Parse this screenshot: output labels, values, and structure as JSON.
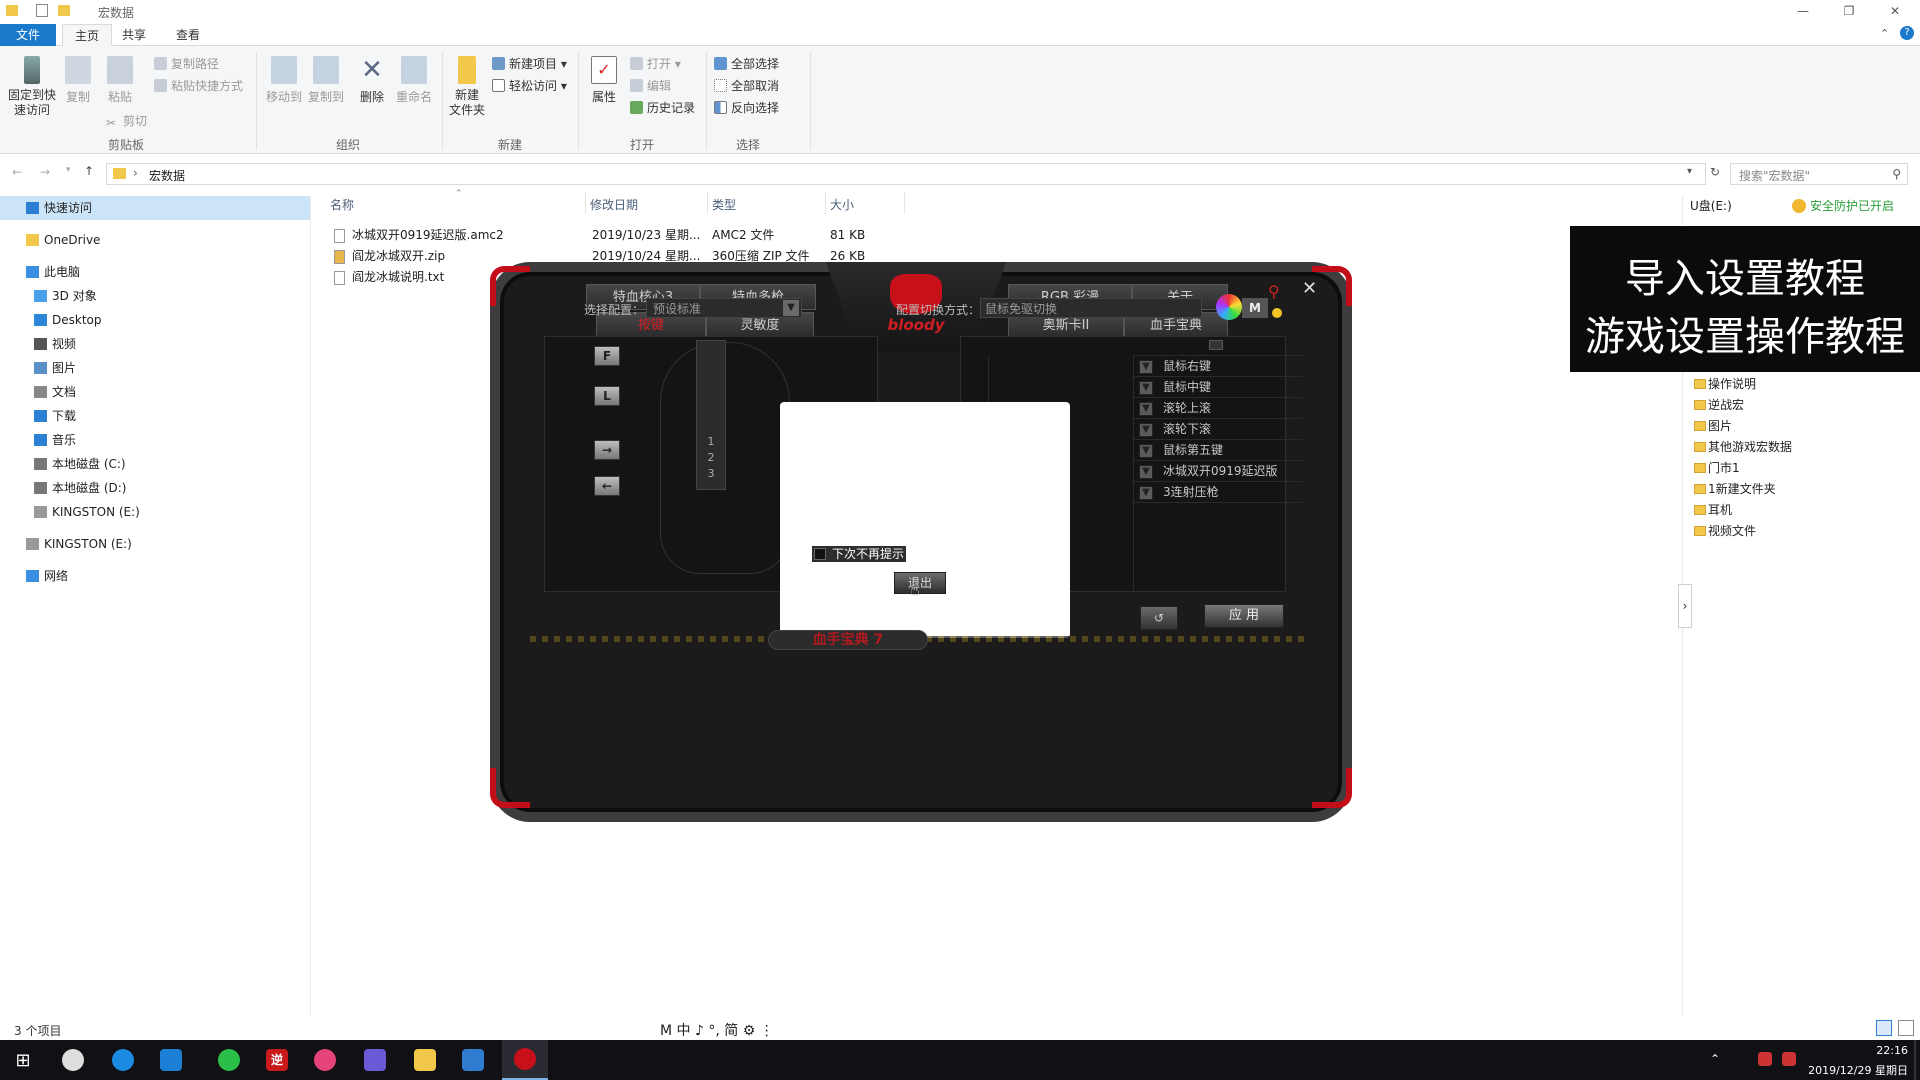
{
  "window": {
    "title": "宏数据"
  },
  "ribbon_tabs": [
    "文件",
    "主页",
    "共享",
    "查看"
  ],
  "ribbon": {
    "pin": "固定到快\n速访问",
    "copy": "复制",
    "paste": "粘贴",
    "copy_path": "复制路径",
    "paste_shortcut": "粘贴快捷方式",
    "cut": "剪切",
    "clipboard_group": "剪贴板",
    "move_to": "移动到",
    "copy_to": "复制到",
    "delete": "删除",
    "rename": "重命名",
    "organize_group": "组织",
    "new_item": "新建项目 ▾",
    "easy_access": "轻松访问 ▾",
    "new_folder": "新建\n文件夹",
    "new_group": "新建",
    "properties": "属性",
    "open": "打开 ▾",
    "edit": "编辑",
    "history": "历史记录",
    "open_group": "打开",
    "select_all": "全部选择",
    "select_none": "全部取消",
    "invert_selection": "反向选择",
    "select_group": "选择"
  },
  "address": {
    "path": "宏数据",
    "search_placeholder": "搜索\"宏数据\""
  },
  "nav": [
    {
      "label": "快速访问",
      "color": "#2d7fd4",
      "selected": true,
      "indent": 0
    },
    {
      "label": "OneDrive",
      "color": "#f2c84b",
      "indent": 0
    },
    {
      "label": "此电脑",
      "color": "#3b8de0",
      "indent": 0
    },
    {
      "label": "3D 对象",
      "color": "#4aa0e6",
      "indent": 1
    },
    {
      "label": "Desktop",
      "color": "#2f86d8",
      "indent": 1
    },
    {
      "label": "视频",
      "color": "#555",
      "indent": 1
    },
    {
      "label": "图片",
      "color": "#5a8fc7",
      "indent": 1
    },
    {
      "label": "文档",
      "color": "#888",
      "indent": 1
    },
    {
      "label": "下载",
      "color": "#2d7fd4",
      "indent": 1
    },
    {
      "label": "音乐",
      "color": "#2d7fd4",
      "indent": 1
    },
    {
      "label": "本地磁盘 (C:)",
      "color": "#777",
      "indent": 1
    },
    {
      "label": "本地磁盘 (D:)",
      "color": "#777",
      "indent": 1
    },
    {
      "label": "KINGSTON (E:)",
      "color": "#999",
      "indent": 1
    },
    {
      "label": "KINGSTON (E:)",
      "color": "#999",
      "indent": 0
    },
    {
      "label": "网络",
      "color": "#3b8de0",
      "indent": 0
    }
  ],
  "columns": {
    "name": "名称",
    "modified": "修改日期",
    "type": "类型",
    "size": "大小"
  },
  "files": [
    {
      "name": "冰城双开0919延迟版.amc2",
      "modified": "2019/10/23 星期...",
      "type": "AMC2 文件",
      "size": "81 KB"
    },
    {
      "name": "阎龙冰城双开.zip",
      "modified": "2019/10/24 星期...",
      "type": "360压缩 ZIP 文件",
      "size": "26 KB"
    },
    {
      "name": "阎龙冰城说明.txt",
      "modified": "",
      "type": "",
      "size": ""
    }
  ],
  "status": {
    "count": "3 个项目",
    "ime": "M 中 ♪ °, 简 ⚙ ⋮"
  },
  "right_panel": {
    "drive": "U盘(E:)",
    "protection": "安全防护已开启",
    "folders": [
      "操作说明",
      "逆战宏",
      "图片",
      "其他游戏宏数据",
      "门市1",
      "1新建文件夹",
      "耳机",
      "视频文件"
    ]
  },
  "overlay": {
    "line1": "导入设置教程",
    "line2": "游戏设置操作教程"
  },
  "app": {
    "tabs_left_top": [
      "特血核心3",
      "特血多枪"
    ],
    "tabs_left_bottom": [
      "按键",
      "灵敏度"
    ],
    "tabs_right_top": [
      "RGB 彩漫",
      "关于"
    ],
    "tabs_right_bottom": [
      "奥斯卡II",
      "血手宝典"
    ],
    "logo": "bloody",
    "select_config_label": "选择配置：",
    "select_config_value": "预设标准",
    "switch_mode_label": "配置切换方式：",
    "switch_mode_value": "鼠标免驱切换",
    "m_label": "M",
    "side_buttons": [
      "F",
      "L",
      "→",
      "←"
    ],
    "macro_rows": [
      "鼠标右键",
      "鼠标中键",
      "滚轮上滚",
      "滚轮下滚",
      "鼠标第五键",
      "冰城双开0919延迟版",
      "3连射压枪"
    ],
    "dialog": {
      "checkbox_label": "下次不再提示",
      "button": "退出"
    },
    "apply": "应 用",
    "footer": "血手宝典 7"
  },
  "taskbar": {
    "time": "22:16",
    "date": "2019/12/29 星期日"
  }
}
